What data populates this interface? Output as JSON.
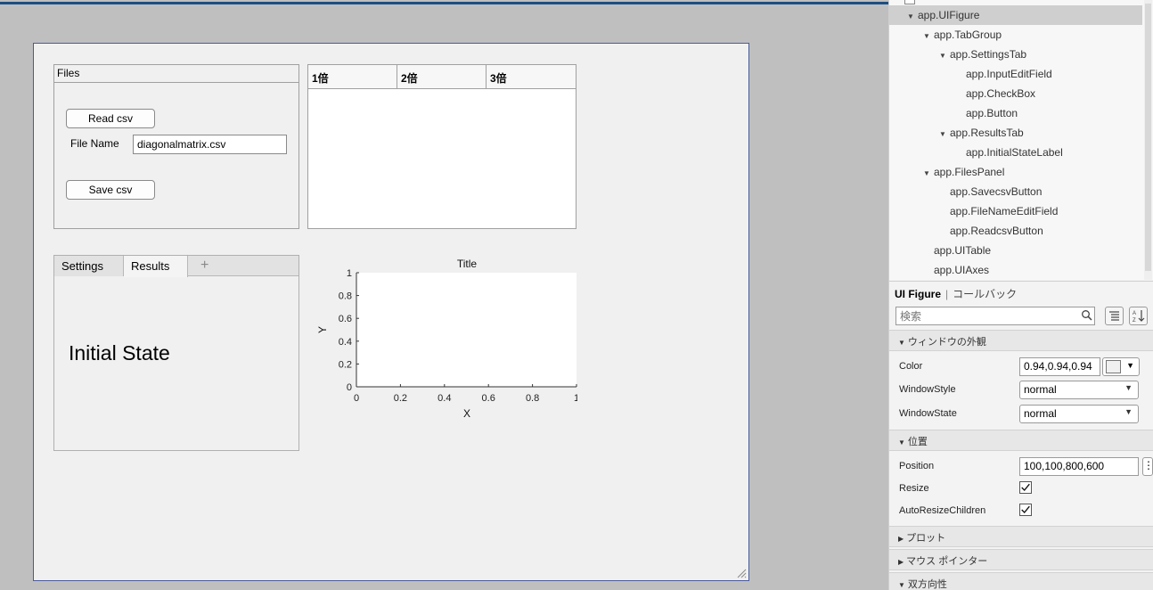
{
  "files_panel": {
    "title": "Files",
    "read_button": "Read csv",
    "file_name_label": "File Name",
    "file_name_value": "diagonalmatrix.csv",
    "save_button": "Save csv"
  },
  "table": {
    "columns": [
      "1倍",
      "2倍",
      "3倍"
    ]
  },
  "tabs": {
    "items": [
      "Settings",
      "Results"
    ],
    "add": "+",
    "active": "Results",
    "initial_state": "Initial State"
  },
  "chart_data": {
    "type": "line",
    "title": "Title",
    "xlabel": "X",
    "ylabel": "Y",
    "xlim": [
      0,
      1
    ],
    "ylim": [
      0,
      1
    ],
    "xticks": [
      "0",
      "0.2",
      "0.4",
      "0.6",
      "0.8",
      "1"
    ],
    "yticks": [
      "0",
      "0.2",
      "0.4",
      "0.6",
      "0.8",
      "1"
    ],
    "series": []
  },
  "component_tree": {
    "nodes": [
      {
        "label": "app.UIFigure",
        "depth": 1,
        "expandable": true,
        "selected": true
      },
      {
        "label": "app.TabGroup",
        "depth": 2,
        "expandable": true
      },
      {
        "label": "app.SettingsTab",
        "depth": 3,
        "expandable": true
      },
      {
        "label": "app.InputEditField",
        "depth": 4
      },
      {
        "label": "app.CheckBox",
        "depth": 4
      },
      {
        "label": "app.Button",
        "depth": 4
      },
      {
        "label": "app.ResultsTab",
        "depth": 3,
        "expandable": true
      },
      {
        "label": "app.InitialStateLabel",
        "depth": 4
      },
      {
        "label": "app.FilesPanel",
        "depth": 2,
        "expandable": true
      },
      {
        "label": "app.SavecsvButton",
        "depth": 3
      },
      {
        "label": "app.FileNameEditField",
        "depth": 3
      },
      {
        "label": "app.ReadcsvButton",
        "depth": 3
      },
      {
        "label": "app.UITable",
        "depth": 2
      },
      {
        "label": "app.UIAxes",
        "depth": 2
      }
    ]
  },
  "inspector": {
    "tab_active": "UI Figure",
    "tab_other": "コールバック",
    "search_placeholder": "検索",
    "sections": {
      "window": "ウィンドウの外観",
      "position": "位置",
      "plot": "プロット",
      "pointer": "マウス ポインター",
      "interactivity": "双方向性"
    },
    "props": {
      "color_label": "Color",
      "color_value": "0.94,0.94,0.94",
      "color_swatch": "#f0f0f0",
      "windowstyle_label": "WindowStyle",
      "windowstyle_value": "normal",
      "windowstate_label": "WindowState",
      "windowstate_value": "normal",
      "position_label": "Position",
      "position_value": "100,100,800,600",
      "resize_label": "Resize",
      "resize_checked": true,
      "autoresize_label": "AutoResizeChildren",
      "autoresize_checked": true
    }
  }
}
